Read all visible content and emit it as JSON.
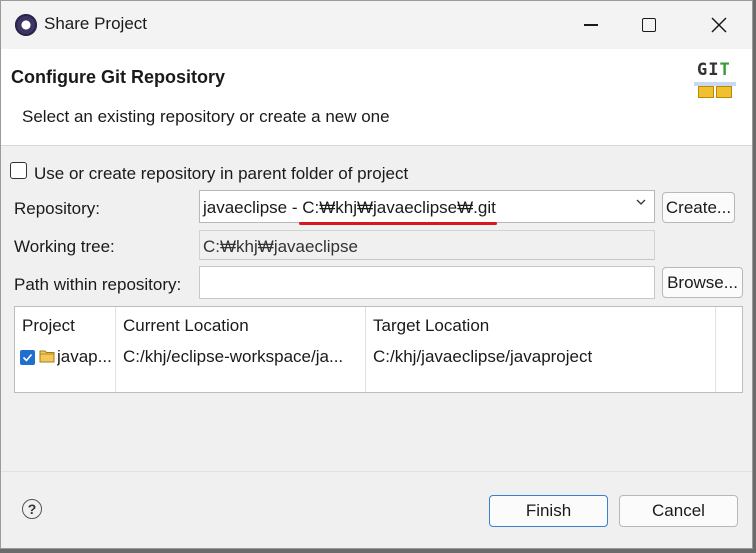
{
  "window": {
    "title": "Share Project"
  },
  "header": {
    "title": "Configure Git Repository",
    "description": "Select an existing repository or create a new one",
    "logo_text_main": "GI",
    "logo_text_accent": "T"
  },
  "form": {
    "parent_folder_label": "Use or create repository in parent folder of project",
    "parent_folder_checked": false,
    "repository_label": "Repository:",
    "repository_value": "javaeclipse - C:₩khj₩javaeclipse₩.git",
    "create_button": "Create...",
    "working_tree_label": "Working tree:",
    "working_tree_value": "C:₩khj₩javaeclipse",
    "path_label": "Path within repository:",
    "path_value": "",
    "browse_button": "Browse..."
  },
  "table": {
    "columns": [
      "Project",
      "Current Location",
      "Target Location"
    ],
    "rows": [
      {
        "checked": true,
        "project": "javap...",
        "current_location": "C:/khj/eclipse-workspace/ja...",
        "target_location": "C:/khj/javaeclipse/javaproject"
      }
    ]
  },
  "footer": {
    "help_icon": "?",
    "finish_button": "Finish",
    "cancel_button": "Cancel"
  },
  "colors": {
    "accent_blue": "#1f6fd0",
    "annotation_red": "#d8161f"
  }
}
